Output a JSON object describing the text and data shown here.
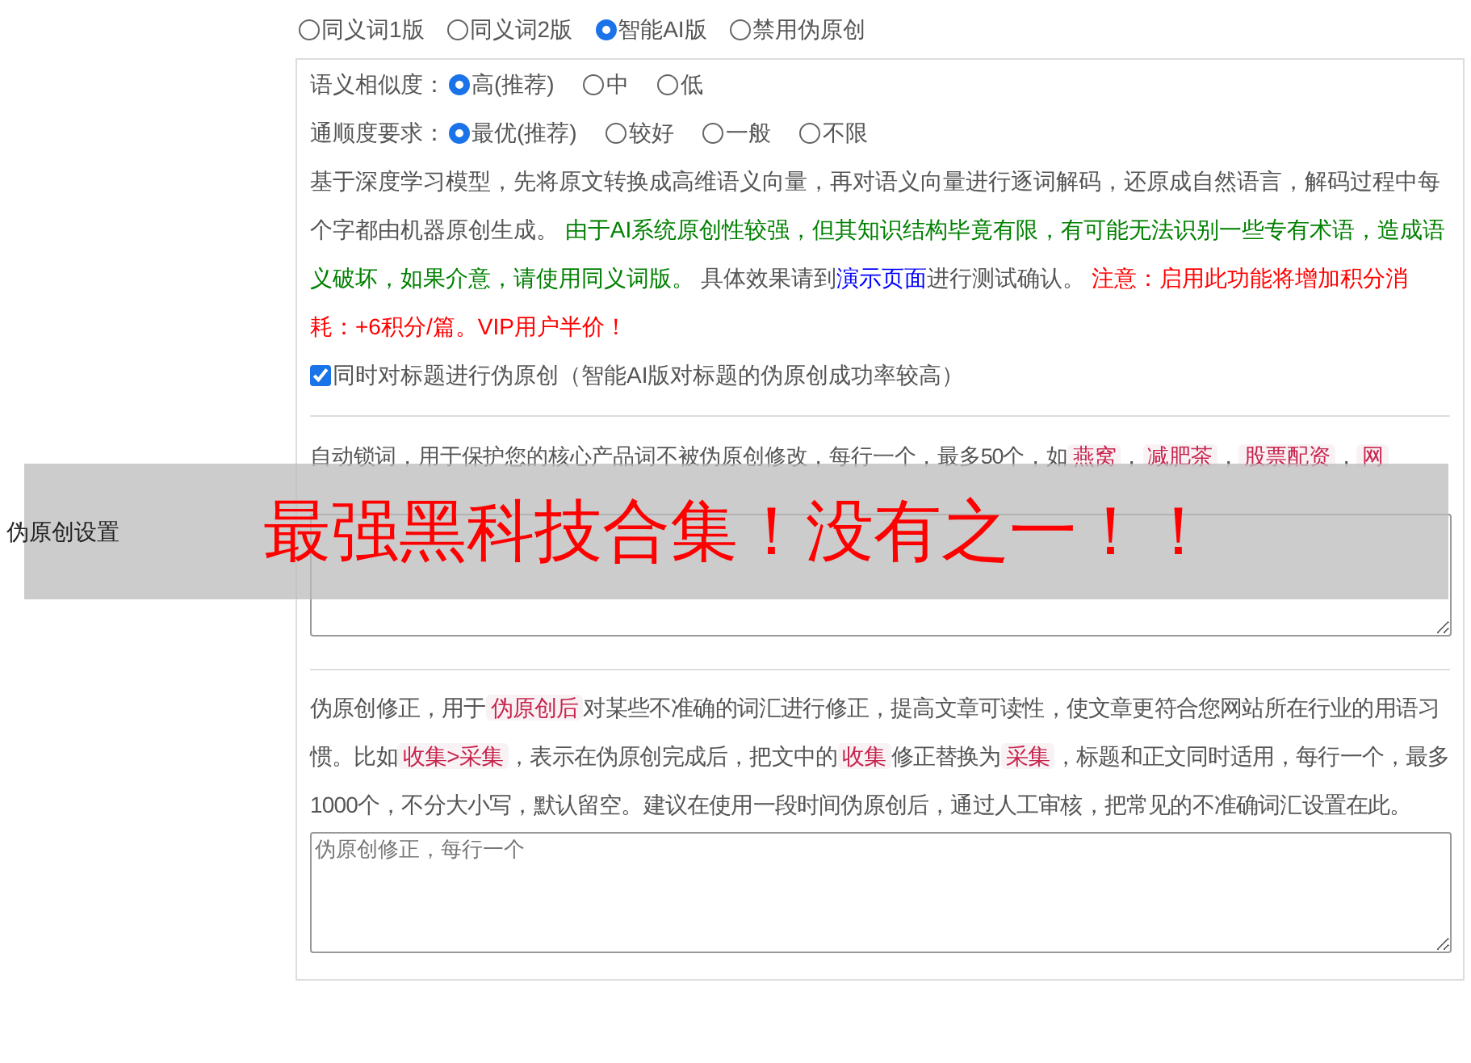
{
  "section_label": "伪原创设置",
  "modes": [
    {
      "label": "同义词1版",
      "selected": false
    },
    {
      "label": "同义词2版",
      "selected": false
    },
    {
      "label": "智能AI版",
      "selected": true
    },
    {
      "label": "禁用伪原创",
      "selected": false
    }
  ],
  "options": [
    {
      "label": "语义相似度：",
      "choices": [
        {
          "label": "高(推荐)",
          "selected": true
        },
        {
          "label": "中",
          "selected": false
        },
        {
          "label": "低",
          "selected": false
        }
      ]
    },
    {
      "label": "通顺度要求：",
      "choices": [
        {
          "label": "最优(推荐)",
          "selected": true
        },
        {
          "label": "较好",
          "selected": false
        },
        {
          "label": "一般",
          "selected": false
        },
        {
          "label": "不限",
          "selected": false
        }
      ]
    }
  ],
  "description": [
    {
      "kind": "plain",
      "text": "基于深度学习模型，先将原文转换成高维语义向量，再对语义向量进行逐词解码，还原成自然语言，解码过程中每个字都由机器原创生成。 "
    },
    {
      "kind": "green",
      "text": "由于AI系统原创性较强，但其知识结构毕竟有限，有可能无法识别一些专有术语，造成语义破坏，如果介意，请使用同义词版。"
    },
    {
      "kind": "plain",
      "text": " 具体效果请到"
    },
    {
      "kind": "link",
      "text": "演示页面"
    },
    {
      "kind": "plain",
      "text": "进行测试确认。 "
    },
    {
      "kind": "red",
      "text": "注意：启用此功能将增加积分消耗：+6积分/篇。VIP用户半价！"
    }
  ],
  "title_option": {
    "label": "同时对标题进行伪原创（智能AI版对标题的伪原创成功率较高）",
    "checked": true
  },
  "lock_words": {
    "text": [
      {
        "kind": "plain",
        "text": "自动锁词，用于保护您的核心产品词不被伪原创修改，每行一个，最多50个，如"
      },
      {
        "kind": "code",
        "text": "燕窝"
      },
      {
        "kind": "plain",
        "text": "，"
      },
      {
        "kind": "code",
        "text": "减肥茶"
      },
      {
        "kind": "plain",
        "text": "，"
      },
      {
        "kind": "code",
        "text": "股票配资"
      },
      {
        "kind": "plain",
        "text": "，"
      },
      {
        "kind": "code",
        "text": "网"
      }
    ]
  },
  "correction": {
    "text": [
      {
        "kind": "plain",
        "text": "伪原创修正，用于"
      },
      {
        "kind": "code",
        "text": "伪原创后"
      },
      {
        "kind": "plain",
        "text": "对某些不准确的词汇进行修正，提高文章可读性，使文章更符合您网站所在行业的用语习惯。比如"
      },
      {
        "kind": "code",
        "text": "收集>采集"
      },
      {
        "kind": "plain",
        "text": "，表示在伪原创完成后，把文中的"
      },
      {
        "kind": "code",
        "text": "收集"
      },
      {
        "kind": "plain",
        "text": "修正替换为"
      },
      {
        "kind": "code",
        "text": "采集"
      },
      {
        "kind": "plain",
        "text": "，标题和正文同时适用，每行一个，最多1000个，不分大小写，默认留空。建议在使用一段时间伪原创后，通过人工审核，把常见的不准确词汇设置在此。"
      }
    ],
    "placeholder": "伪原创修正，每行一个"
  },
  "banner": {
    "text": "最强黑科技合集！没有之一！！"
  }
}
